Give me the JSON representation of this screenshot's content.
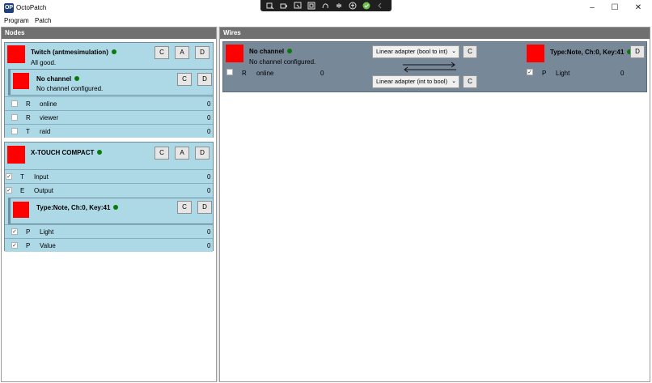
{
  "window": {
    "title": "OctoPatch",
    "icon_text": "OP",
    "minimize": "–",
    "maximize": "☐",
    "close": "✕"
  },
  "capture_toolbar": {
    "icons": [
      "screenshot-icon",
      "video-icon",
      "region-icon",
      "window-icon",
      "freeform-icon",
      "touch-icon",
      "accessibility-icon",
      "checkmark-icon",
      "chevron-left-icon"
    ]
  },
  "menu": {
    "items": [
      "Program",
      "Patch"
    ]
  },
  "nodes_panel": {
    "title": "Nodes",
    "twitch": {
      "title": "Twitch (antmesimulation)",
      "status": "All good.",
      "buttons": [
        "C",
        "A",
        "D"
      ],
      "child": {
        "title": "No channel",
        "status": "No channel configured.",
        "buttons": [
          "C",
          "D"
        ],
        "rows": [
          {
            "type": "R",
            "name": "online",
            "value": "0",
            "checked": false
          },
          {
            "type": "R",
            "name": "viewer",
            "value": "0",
            "checked": false
          },
          {
            "type": "T",
            "name": "raid",
            "value": "0",
            "checked": false
          }
        ]
      }
    },
    "xtouch": {
      "title": "X-TOUCH COMPACT",
      "buttons": [
        "C",
        "A",
        "D"
      ],
      "rows": [
        {
          "type": "T",
          "name": "Input",
          "value": "0",
          "checked": true,
          "check_mark": "✓"
        },
        {
          "type": "E",
          "name": "Output",
          "value": "0",
          "checked": true,
          "check_mark": "✓"
        }
      ],
      "child": {
        "title": "Type:Note, Ch:0, Key:41",
        "buttons": [
          "C",
          "D"
        ],
        "rows": [
          {
            "type": "P",
            "name": "Light",
            "value": "0",
            "checked": true,
            "check_mark": "✓"
          },
          {
            "type": "P",
            "name": "Value",
            "value": "0",
            "checked": true,
            "check_mark": "✓"
          }
        ]
      }
    }
  },
  "wires_panel": {
    "title": "Wires",
    "wire": {
      "source": {
        "title": "No channel",
        "status": "No channel configured.",
        "row": {
          "type": "R",
          "name": "online",
          "value": "0"
        }
      },
      "adapter_top": {
        "label": "Linear adapter (bool to int)",
        "button": "C"
      },
      "adapter_bottom": {
        "label": "Linear adapter (int to bool)",
        "button": "C"
      },
      "target": {
        "title": "Type:Note, Ch:0, Key:41",
        "button": "D",
        "row": {
          "type": "P",
          "name": "Light",
          "value": "0",
          "check_mark": "✓"
        }
      }
    }
  },
  "colors": {
    "node_bg": "#add8e6",
    "wire_bg": "#778899",
    "header_bg": "#707070",
    "status_dot": "#0a7a0a",
    "node_color": "#ff0000"
  }
}
